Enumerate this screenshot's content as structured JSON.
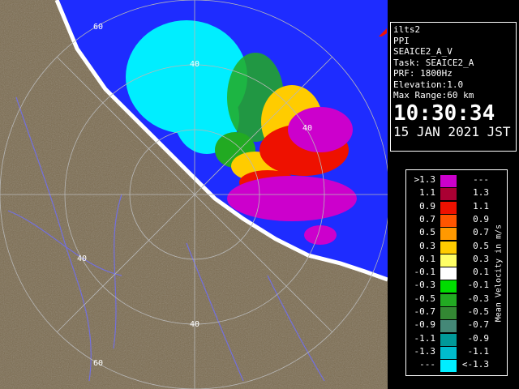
{
  "info": {
    "station": "ilts2",
    "scan_type": "PPI",
    "product": "SEAICE2_A_V",
    "task": "Task: SEAICE2_A",
    "prf": "PRF: 1800Hz",
    "elevation": "Elevation:1.0",
    "max_range": "Max Range:60 km",
    "time": "10:30:34",
    "date": "15 JAN 2021 JST"
  },
  "legend": {
    "unit": "Mean Velocity in m/s",
    "rows": [
      {
        "a": ">1.3",
        "b": "---",
        "color": "#cc00cc"
      },
      {
        "a": "1.1",
        "b": "1.3",
        "color": "#aa0033"
      },
      {
        "a": "0.9",
        "b": "1.1",
        "color": "#ee1100"
      },
      {
        "a": "0.7",
        "b": "0.9",
        "color": "#ff5500"
      },
      {
        "a": "0.5",
        "b": "0.7",
        "color": "#ff9900"
      },
      {
        "a": "0.3",
        "b": "0.5",
        "color": "#ffcc00"
      },
      {
        "a": "0.1",
        "b": "0.3",
        "color": "#ffff66"
      },
      {
        "a": "-0.1",
        "b": "0.1",
        "color": "#ffffff"
      },
      {
        "a": "-0.3",
        "b": "-0.1",
        "color": "#00dd00"
      },
      {
        "a": "-0.5",
        "b": "-0.3",
        "color": "#22aa22"
      },
      {
        "a": "-0.7",
        "b": "-0.5",
        "color": "#338833"
      },
      {
        "a": "-0.9",
        "b": "-0.7",
        "color": "#448877"
      },
      {
        "a": "-1.1",
        "b": "-0.9",
        "color": "#009999"
      },
      {
        "a": "-1.3",
        "b": "-1.1",
        "color": "#00bbcc"
      },
      {
        "a": "---",
        "b": "<-1.3",
        "color": "#00eeff"
      }
    ]
  },
  "range_labels": [
    "60",
    "40",
    "40",
    "40",
    "40",
    "60"
  ],
  "colors": {
    "sea": "#1e2cff",
    "land": "#7a6a4e"
  }
}
